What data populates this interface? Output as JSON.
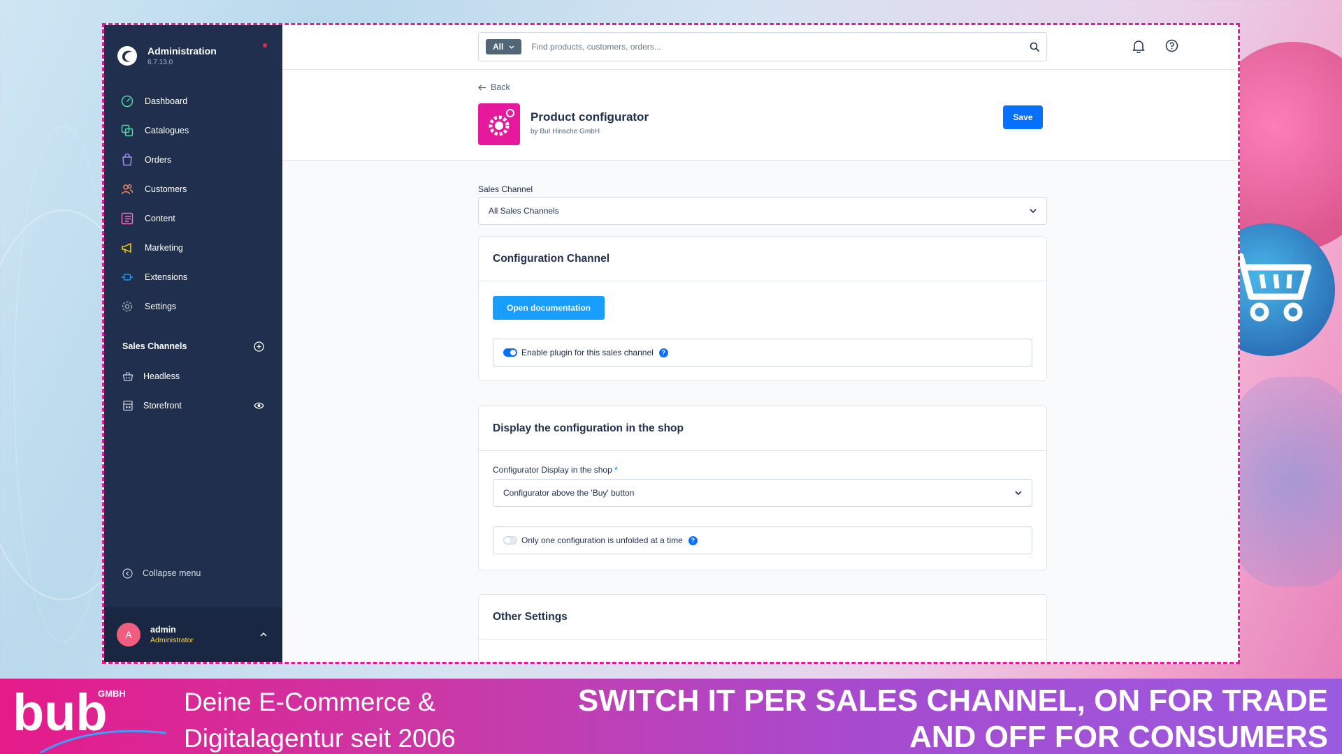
{
  "admin": {
    "title": "Administration",
    "version": "6.7.13.0"
  },
  "nav": [
    {
      "label": "Dashboard",
      "icon": "dashboard-icon",
      "color": "#57d9a3"
    },
    {
      "label": "Catalogues",
      "icon": "catalogue-icon",
      "color": "#57d9a3"
    },
    {
      "label": "Orders",
      "icon": "orders-icon",
      "color": "#a092f0"
    },
    {
      "label": "Customers",
      "icon": "customers-icon",
      "color": "#f88962"
    },
    {
      "label": "Content",
      "icon": "content-icon",
      "color": "#ff68b4"
    },
    {
      "label": "Marketing",
      "icon": "marketing-icon",
      "color": "#ffd700"
    },
    {
      "label": "Extensions",
      "icon": "extensions-icon",
      "color": "#189eff"
    },
    {
      "label": "Settings",
      "icon": "settings-icon",
      "color": "#9aa8b5"
    }
  ],
  "sales_channels": {
    "header": "Sales Channels",
    "items": [
      {
        "label": "Headless",
        "icon": "basket-icon"
      },
      {
        "label": "Storefront",
        "icon": "storefront-icon"
      }
    ]
  },
  "collapse_label": "Collapse menu",
  "user": {
    "initial": "A",
    "name": "admin",
    "role": "Administrator"
  },
  "search": {
    "type": "All",
    "placeholder": "Find products, customers, orders..."
  },
  "page": {
    "back_label": "Back",
    "title": "Product configurator",
    "by": "by BuI Hinsche GmbH",
    "save_label": "Save"
  },
  "sales_channel": {
    "label": "Sales Channel",
    "value": "All Sales Channels"
  },
  "config_channel": {
    "title": "Configuration Channel",
    "doc_button": "Open documentation",
    "enable_label": "Enable plugin for this sales channel",
    "enable_value": true
  },
  "display_config": {
    "title": "Display the configuration in the shop",
    "display_label": "Configurator Display in the shop",
    "required_mark": "*",
    "display_value": "Configurator above the 'Buy' button",
    "unfold_label": "Only one configuration is unfolded at a time",
    "unfold_value": false
  },
  "other_settings": {
    "title": "Other Settings"
  },
  "banner": {
    "brand_text": "bub",
    "brand_sub": "GMBH",
    "tagline_line1": "Deine E-Commerce &",
    "tagline_line2": "Digitalagentur seit 2006",
    "headline_line1": "SWITCH IT PER SALES CHANNEL, ON FOR TRADE",
    "headline_line2": "AND OFF FOR CONSUMERS"
  },
  "colors": {
    "accent": "#0870ff",
    "frame_border": "#e6189b",
    "sidebar": "#1f2f4d",
    "banner_start": "#e51b8a",
    "banner_end": "#9b5be0"
  }
}
